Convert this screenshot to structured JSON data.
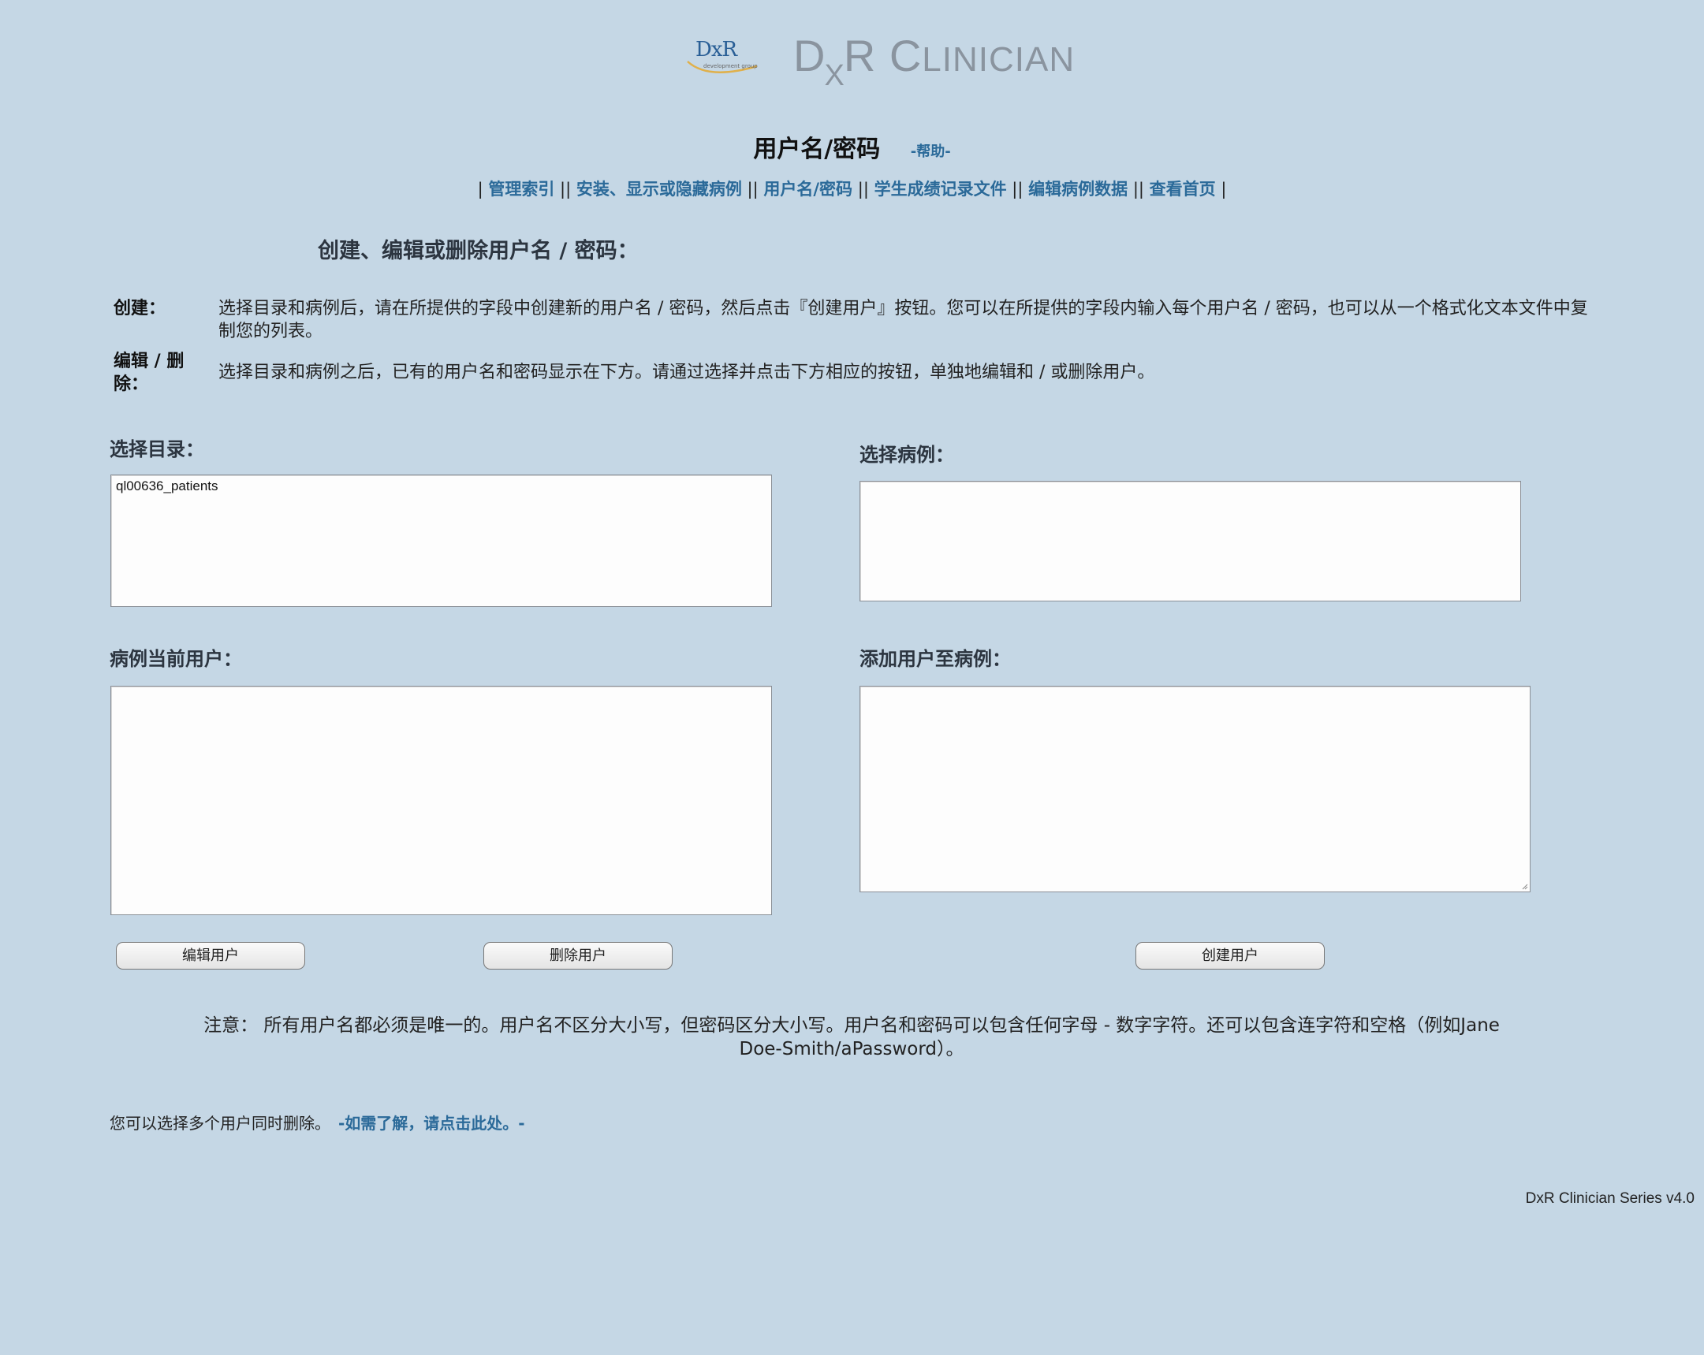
{
  "header": {
    "logo_small_text": "DxR",
    "logo_small_subtext": "development group",
    "logo_big_d": "D",
    "logo_big_x": "X",
    "logo_big_r": "R",
    "logo_big_c": "C",
    "logo_big_rest": "LINICIAN"
  },
  "page": {
    "title": "用户名/密码",
    "help_link": "-帮助-"
  },
  "nav": {
    "items": [
      "管理索引",
      "安装、显示或隐藏病例",
      "用户名/密码",
      "学生成绩记录文件",
      "编辑病例数据",
      "查看首页"
    ],
    "separator_open": "|",
    "separator_mid": "||",
    "separator_close": "|"
  },
  "section_title": "创建、编辑或删除用户名 / 密码：",
  "definitions": {
    "create_term": "创建：",
    "create_body": "选择目录和病例后，请在所提供的字段中创建新的用户名 / 密码，然后点击『创建用户』按钮。您可以在所提供的字段内输入每个用户名 / 密码，也可以从一个格式化文本文件中复制您的列表。",
    "edit_term": "编辑 / 删除：",
    "edit_body": "选择目录和病例之后，已有的用户名和密码显示在下方。请通过选择并点击下方相应的按钮，单独地编辑和 / 或删除用户。"
  },
  "directory": {
    "label": "选择目录：",
    "options": [
      "ql00636_patients"
    ]
  },
  "case": {
    "label": "选择病例：",
    "options": []
  },
  "current_users": {
    "label": "病例当前用户："
  },
  "add_users": {
    "label": "添加用户至病例：",
    "value": ""
  },
  "buttons": {
    "edit_user": "编辑用户",
    "delete_user": "删除用户",
    "create_user": "创建用户"
  },
  "note": "注意：  所有用户名都必须是唯一的。用户名不区分大小写，但密码区分大小写。用户名和密码可以包含任何字母 - 数字字符。还可以包含连字符和空格（例如Jane Doe-Smith/aPassword）。",
  "multi_delete": {
    "text": "您可以选择多个用户同时删除。",
    "link": "-如需了解，请点击此处。-"
  },
  "version": "DxR Clinician Series v4.0"
}
